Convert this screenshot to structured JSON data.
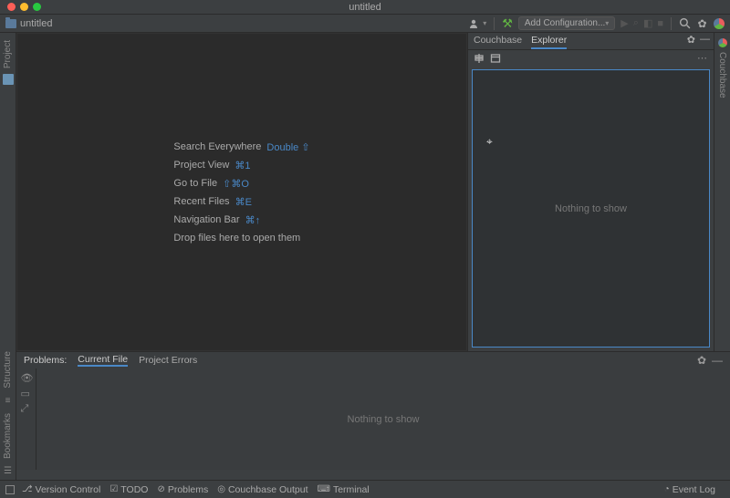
{
  "window": {
    "title": "untitled"
  },
  "breadcrumb": {
    "project": "untitled"
  },
  "toolbar": {
    "add_config": "Add Configuration..."
  },
  "hints": {
    "search_everywhere": {
      "label": "Search Everywhere",
      "shortcut": "Double ⇧"
    },
    "project_view": {
      "label": "Project View",
      "shortcut": "⌘1"
    },
    "go_to_file": {
      "label": "Go to File",
      "shortcut": "⇧⌘O"
    },
    "recent_files": {
      "label": "Recent Files",
      "shortcut": "⌘E"
    },
    "navigation_bar": {
      "label": "Navigation Bar",
      "shortcut": "⌘↑"
    },
    "drop_files": {
      "label": "Drop files here to open them"
    }
  },
  "right_panel": {
    "tabs": {
      "couchbase": "Couchbase",
      "explorer": "Explorer"
    },
    "empty": "Nothing to show"
  },
  "left_tools": {
    "project": "Project",
    "structure": "Structure",
    "bookmarks": "Bookmarks"
  },
  "right_tools": {
    "couchbase": "Couchbase"
  },
  "problems": {
    "title": "Problems:",
    "tabs": {
      "current": "Current File",
      "project": "Project Errors"
    },
    "empty": "Nothing to show"
  },
  "status": {
    "version_control": "Version Control",
    "todo": "TODO",
    "problems": "Problems",
    "couchbase_output": "Couchbase Output",
    "terminal": "Terminal",
    "event_log": "Event Log"
  }
}
